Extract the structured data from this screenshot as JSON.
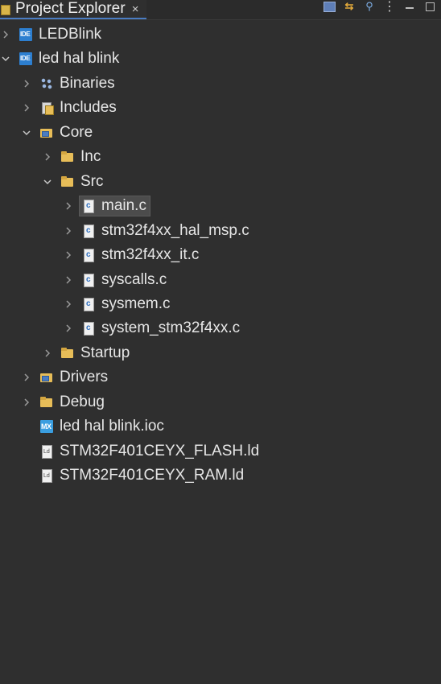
{
  "tab": {
    "title": "Project Explorer",
    "close": "×"
  },
  "toolbar": {
    "collapse_all": "collapse-all-icon",
    "link_editor": "⇆",
    "filter": "⚲",
    "view_menu": "⋮"
  },
  "tree": [
    {
      "label": "LEDBlink",
      "icon": "ide",
      "expanded": false,
      "selected": false
    },
    {
      "label": "led hal blink",
      "icon": "ide",
      "expanded": true,
      "selected": false
    },
    {
      "label": "Binaries",
      "icon": "binaries",
      "expanded": false,
      "selected": false
    },
    {
      "label": "Includes",
      "icon": "includes",
      "expanded": false,
      "selected": false
    },
    {
      "label": "Core",
      "icon": "srcfolder",
      "expanded": true,
      "selected": false
    },
    {
      "label": "Inc",
      "icon": "folder",
      "expanded": false,
      "selected": false
    },
    {
      "label": "Src",
      "icon": "folder",
      "expanded": true,
      "selected": false
    },
    {
      "label": "main.c",
      "icon": "cfile",
      "expanded": false,
      "selected": true
    },
    {
      "label": "stm32f4xx_hal_msp.c",
      "icon": "cfile",
      "expanded": false,
      "selected": false
    },
    {
      "label": "stm32f4xx_it.c",
      "icon": "cfile",
      "expanded": false,
      "selected": false
    },
    {
      "label": "syscalls.c",
      "icon": "cfile",
      "expanded": false,
      "selected": false
    },
    {
      "label": "sysmem.c",
      "icon": "cfile",
      "expanded": false,
      "selected": false
    },
    {
      "label": "system_stm32f4xx.c",
      "icon": "cfile",
      "expanded": false,
      "selected": false
    },
    {
      "label": "Startup",
      "icon": "folder",
      "expanded": false,
      "selected": false
    },
    {
      "label": "Drivers",
      "icon": "srcfolder",
      "expanded": false,
      "selected": false
    },
    {
      "label": "Debug",
      "icon": "folder",
      "expanded": false,
      "selected": false
    },
    {
      "label": "led hal blink.ioc",
      "icon": "mx",
      "expanded": null,
      "selected": false
    },
    {
      "label": "STM32F401CEYX_FLASH.ld",
      "icon": "ld",
      "expanded": null,
      "selected": false
    },
    {
      "label": "STM32F401CEYX_RAM.ld",
      "icon": "ld",
      "expanded": null,
      "selected": false
    }
  ],
  "colors": {
    "background": "#2f2f2f",
    "selection": "#4c4c4c",
    "text": "#e6e6e6",
    "tab_accent": "#4a7cc2"
  }
}
